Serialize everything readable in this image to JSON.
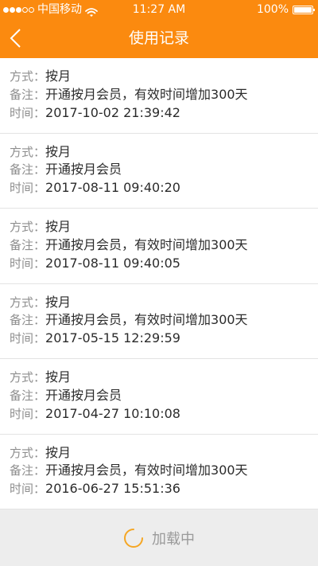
{
  "status_bar": {
    "carrier": "中国移动",
    "time": "11:27 AM",
    "battery": "100%",
    "signal_bars_filled": 3,
    "signal_bars_total": 5
  },
  "nav": {
    "title": "使用记录",
    "back_icon": "chevron-left-icon"
  },
  "labels": {
    "method": "方式：",
    "note": "备注：",
    "time": "时间："
  },
  "records": [
    {
      "method": "按月",
      "note": "开通按月会员，有效时间增加300天",
      "time": "2017-10-02 21:39:42"
    },
    {
      "method": "按月",
      "note": "开通按月会员",
      "time": "2017-08-11 09:40:20"
    },
    {
      "method": "按月",
      "note": "开通按月会员，有效时间增加300天",
      "time": "2017-08-11 09:40:05"
    },
    {
      "method": "按月",
      "note": "开通按月会员，有效时间增加300天",
      "time": "2017-05-15 12:29:59"
    },
    {
      "method": "按月",
      "note": "开通按月会员",
      "time": "2017-04-27 10:10:08"
    },
    {
      "method": "按月",
      "note": "开通按月会员，有效时间增加300天",
      "time": "2016-06-27 15:51:36"
    }
  ],
  "footer": {
    "loading": "加载中",
    "spinner_icon": "loading-spinner-icon"
  },
  "colors": {
    "accent": "#fb8a0f",
    "spinner": "#f5a623"
  }
}
